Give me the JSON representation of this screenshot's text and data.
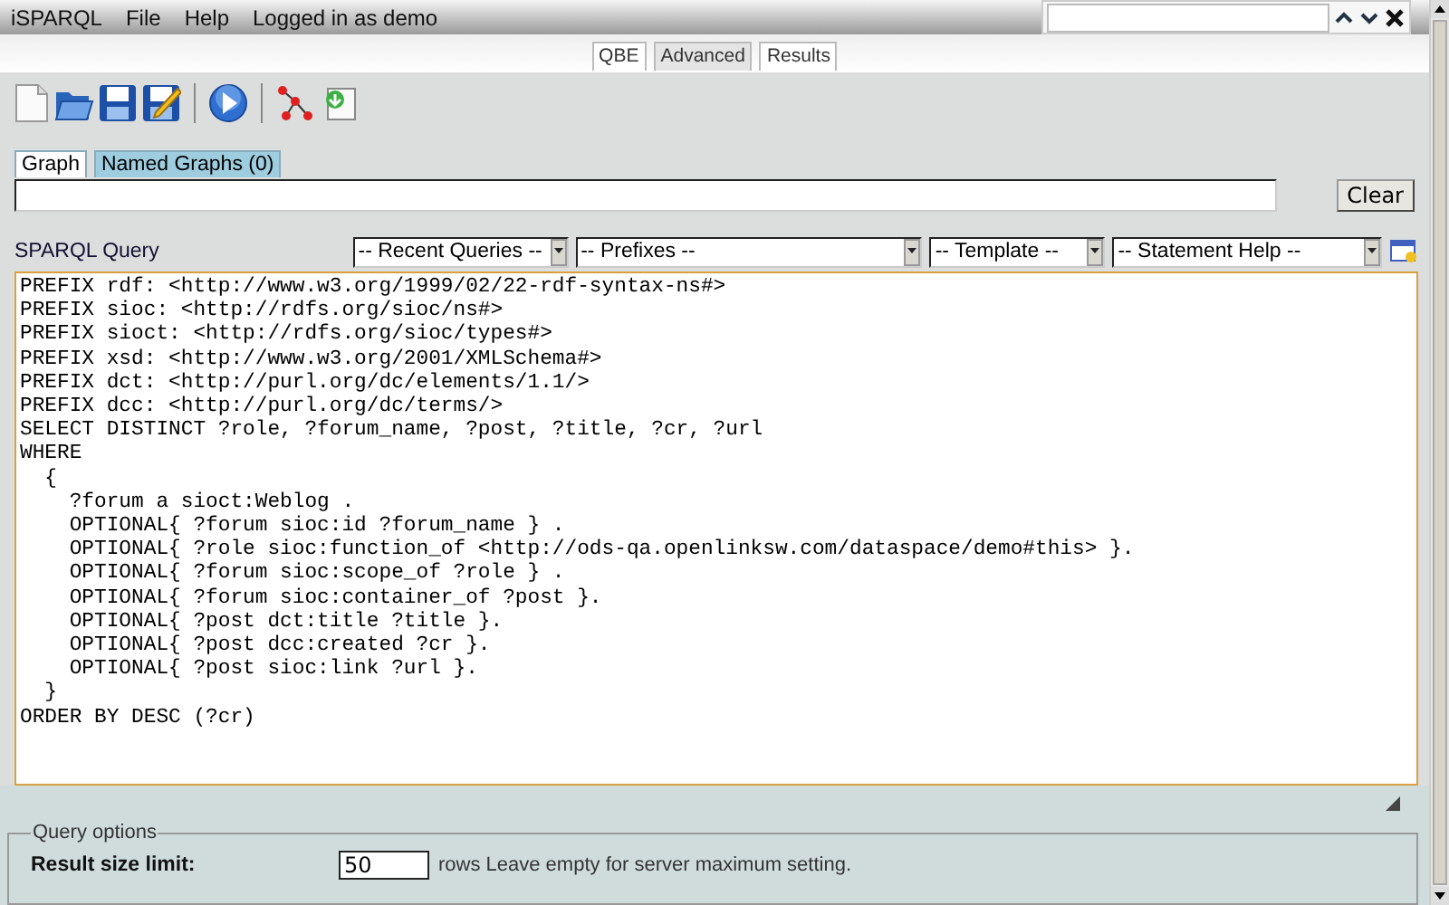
{
  "menubar": {
    "items": [
      "iSPARQL",
      "File",
      "Help",
      "Logged in as demo"
    ]
  },
  "view_tabs": [
    {
      "label": "QBE",
      "selected": false
    },
    {
      "label": "Advanced",
      "selected": true
    },
    {
      "label": "Results",
      "selected": false
    }
  ],
  "toolbar": [
    {
      "kind": "new"
    },
    {
      "kind": "open"
    },
    {
      "kind": "save"
    },
    {
      "kind": "save-as"
    },
    {
      "kind": "separator"
    },
    {
      "kind": "run"
    },
    {
      "kind": "separator"
    },
    {
      "kind": "graph"
    },
    {
      "kind": "load"
    }
  ],
  "graph_tabs": [
    {
      "label": "Graph",
      "selected": true
    },
    {
      "label": "Named Graphs (0)",
      "selected": false
    }
  ],
  "clear_button": "Clear",
  "query": {
    "label": "SPARQL Query",
    "dropdowns": [
      "-- Recent Queries --",
      "-- Prefixes --",
      "-- Template --",
      "-- Statement Help --"
    ],
    "text": "PREFIX rdf: <http://www.w3.org/1999/02/22-rdf-syntax-ns#>\nPREFIX sioc: <http://rdfs.org/sioc/ns#>\nPREFIX sioct: <http://rdfs.org/sioc/types#>\nPREFIX xsd: <http://www.w3.org/2001/XMLSchema#>\nPREFIX dct: <http://purl.org/dc/elements/1.1/>\nPREFIX dcc: <http://purl.org/dc/terms/>\nSELECT DISTINCT ?role, ?forum_name, ?post, ?title, ?cr, ?url\nWHERE\n  {\n    ?forum a sioct:Weblog .\n    OPTIONAL{ ?forum sioc:id ?forum_name } .\n    OPTIONAL{ ?role sioc:function_of <http://ods-qa.openlinksw.com/dataspace/demo#this> }.\n    OPTIONAL{ ?forum sioc:scope_of ?role } .\n    OPTIONAL{ ?forum sioc:container_of ?post }.\n    OPTIONAL{ ?post dct:title ?title }.\n    OPTIONAL{ ?post dcc:created ?cr }.\n    OPTIONAL{ ?post sioc:link ?url }.\n  }\nORDER BY DESC (?cr)"
  },
  "query_options": {
    "legend": "Query options",
    "limit_label": "Result size limit:",
    "limit_value": "50",
    "limit_hint": "rows Leave empty for server maximum setting."
  }
}
